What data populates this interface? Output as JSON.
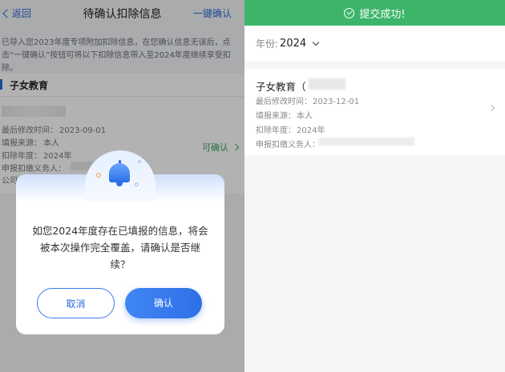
{
  "left": {
    "nav": {
      "back_label": "返回",
      "title": "待确认扣除信息",
      "action_label": "一键确认"
    },
    "notice": "已导入您2023年度专项附加扣除信息，在您确认信息无误后，点击“一键确认”按钮可将以下扣除信息带入至2024年度继续享受扣除。",
    "section_title": "子女教育",
    "item": {
      "modified_label": "最后修改时间：",
      "modified_value": "2023-09-01",
      "source_label": "填报来源：",
      "source_value": "本人",
      "year_label": "扣除年度：",
      "year_value": "2024年",
      "agent_label": "申报扣缴义务人：",
      "company_label": "公司",
      "confirm_label": "可确认"
    },
    "dialog": {
      "message": "如您2024年度存在已填报的信息，将会被本次操作完全覆盖，请确认是否继续？",
      "cancel_label": "取消",
      "confirm_label": "确认"
    }
  },
  "right": {
    "banner": "提交成功!",
    "year_label": "年份:",
    "year_value": "2024",
    "card": {
      "title": "子女教育（",
      "modified_label": "最后修改时间：",
      "modified_value": "2023-12-01",
      "source_label": "填报来源：",
      "source_value": "本人",
      "year_label": "扣除年度：",
      "year_value": "2024年",
      "agent_label": "申报扣缴义务人："
    }
  },
  "colors": {
    "primary": "#2a6bd8",
    "success": "#3cb56a",
    "confirm_green": "#3aa35c"
  }
}
